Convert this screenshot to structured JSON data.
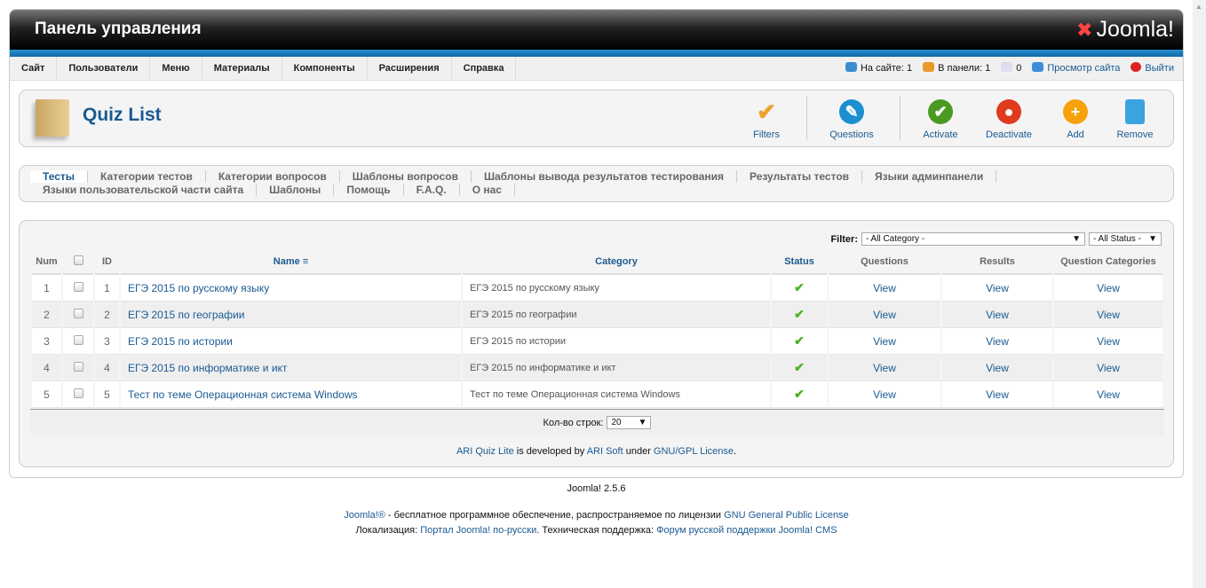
{
  "header": {
    "title": "Панель управления",
    "logo": "Joomla!"
  },
  "menu": [
    "Сайт",
    "Пользователи",
    "Меню",
    "Материалы",
    "Компоненты",
    "Расширения",
    "Справка"
  ],
  "status": {
    "on_site": "На сайте: 1",
    "in_panel": "В панели: 1",
    "messages": "0",
    "view_site": "Просмотр сайта",
    "logout": "Выйти"
  },
  "toolbar": {
    "title": "Quiz List",
    "buttons": [
      "Filters",
      "Questions",
      "Activate",
      "Deactivate",
      "Add",
      "Remove"
    ]
  },
  "submenu": {
    "row1": [
      "Тесты",
      "Категории тестов",
      "Категории вопросов",
      "Шаблоны вопросов",
      "Шаблоны вывода результатов тестирования",
      "Результаты тестов",
      "Языки админпанели"
    ],
    "row2": [
      "Языки пользовательской части сайта",
      "Шаблоны",
      "Помощь",
      "F.A.Q.",
      "О нас"
    ]
  },
  "filter": {
    "label": "Filter:",
    "category": "- All Category -",
    "status": "- All Status -"
  },
  "table": {
    "headers": [
      "Num",
      "ID",
      "Name",
      "Category",
      "Status",
      "Questions",
      "Results",
      "Question Categories"
    ],
    "rows": [
      {
        "num": "1",
        "id": "1",
        "name": "ЕГЭ 2015 по русскому языку",
        "category": "ЕГЭ 2015 по русскому языку",
        "q": "View",
        "r": "View",
        "qc": "View"
      },
      {
        "num": "2",
        "id": "2",
        "name": "ЕГЭ 2015 по географии",
        "category": "ЕГЭ 2015 по географии",
        "q": "View",
        "r": "View",
        "qc": "View"
      },
      {
        "num": "3",
        "id": "3",
        "name": "ЕГЭ 2015 по истории",
        "category": "ЕГЭ 2015 по истории",
        "q": "View",
        "r": "View",
        "qc": "View"
      },
      {
        "num": "4",
        "id": "4",
        "name": "ЕГЭ 2015 по информатике и икт",
        "category": "ЕГЭ 2015 по информатике и икт",
        "q": "View",
        "r": "View",
        "qc": "View"
      },
      {
        "num": "5",
        "id": "5",
        "name": "Тест по теме Операционная система Windows",
        "category": "Тест по теме Операционная система Windows",
        "q": "View",
        "r": "View",
        "qc": "View"
      }
    ]
  },
  "pagination": {
    "label": "Кол-во строк:",
    "value": "20"
  },
  "credit": {
    "product": "ARI Quiz Lite",
    "t1": " is developed by ",
    "company": "ARI Soft",
    "t2": " under ",
    "license": "GNU/GPL License",
    "t3": "."
  },
  "footer": {
    "version": "Joomla! 2.5.6",
    "l1a": "Joomla!®",
    "l1b": " - бесплатное программное обеспечение, распространяемое по лицензии ",
    "l1c": "GNU General Public License",
    "l2a": "Локализация: ",
    "l2b": "Портал Joomla! по-русски",
    "l2c": ". Техническая поддержка: ",
    "l2d": "Форум русской поддержки Joomla! CMS"
  }
}
